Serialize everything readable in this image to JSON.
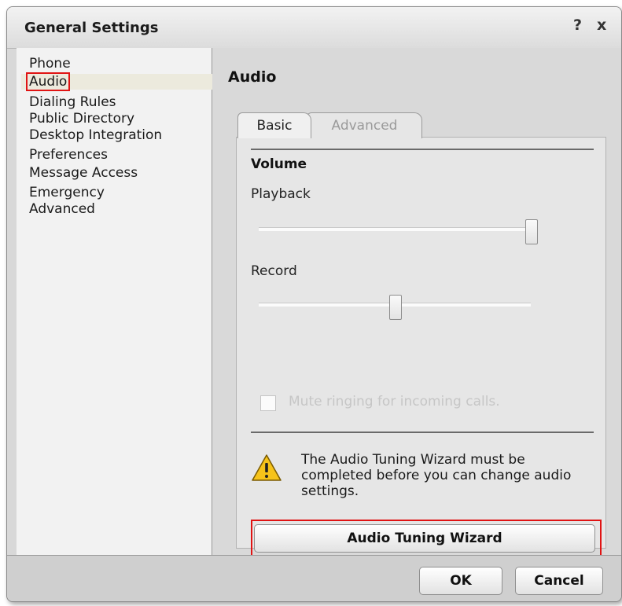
{
  "window": {
    "title": "General Settings",
    "help_glyph": "?",
    "close_glyph": "x"
  },
  "sidebar": {
    "items": [
      {
        "label": "Phone",
        "selected": false
      },
      {
        "label": "Audio",
        "selected": true
      },
      {
        "label": "Dialing Rules",
        "selected": false
      },
      {
        "label": "Public Directory",
        "selected": false
      },
      {
        "label": "Desktop Integration",
        "selected": false
      },
      {
        "label": "Preferences",
        "selected": false
      },
      {
        "label": "Message Access",
        "selected": false
      },
      {
        "label": "Emergency",
        "selected": false
      },
      {
        "label": "Advanced",
        "selected": false
      }
    ]
  },
  "main": {
    "section_title": "Audio",
    "tabs": [
      {
        "label": "Basic",
        "active": true
      },
      {
        "label": "Advanced",
        "active": false
      }
    ],
    "volume": {
      "heading": "Volume",
      "playback": {
        "label": "Playback",
        "level": 1.0
      },
      "record": {
        "label": "Record",
        "level": 0.5
      }
    },
    "mute_checkbox": {
      "label": "Mute ringing for incoming calls.",
      "checked": false,
      "enabled": false
    },
    "warning": {
      "icon": "warning-icon",
      "text": "The Audio Tuning Wizard must be completed before you can change audio settings."
    },
    "wizard_button": "Audio Tuning Wizard"
  },
  "footer": {
    "ok_label": "OK",
    "cancel_label": "Cancel"
  },
  "colors": {
    "highlight": "#e01414",
    "selected_row": "#eceadd",
    "warning_yellow": "#f6c31a"
  }
}
